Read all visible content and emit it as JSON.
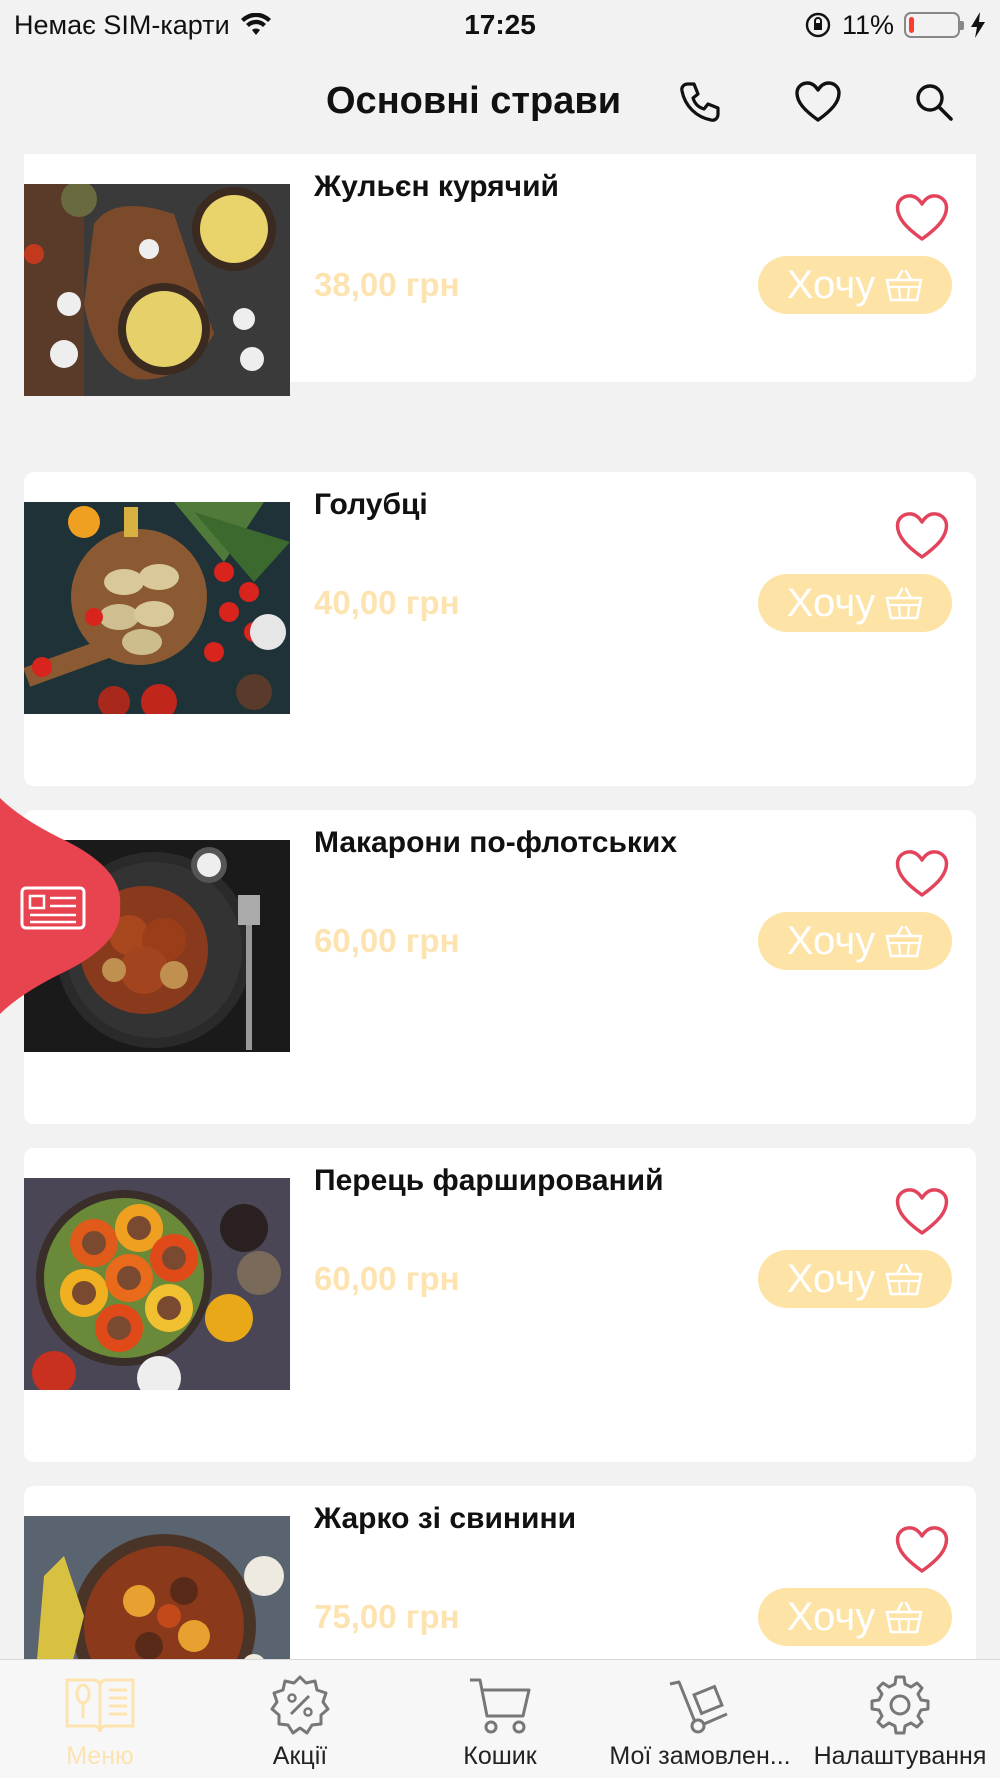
{
  "status_bar": {
    "carrier": "Немає SIM-карти",
    "time": "17:25",
    "battery_percent": "11%",
    "battery_level": 0.11
  },
  "header": {
    "title": "Основні страви",
    "icons": [
      "phone-icon",
      "heart-icon",
      "search-icon"
    ]
  },
  "colors": {
    "accent": "#fde3a6",
    "price": "#fde3b0",
    "heart": "#e2445c",
    "side_tab": "#e8444f"
  },
  "dishes": [
    {
      "name": "Жульєн курячий",
      "price": "38,00 грн",
      "button": "Хочу"
    },
    {
      "name": "Голубці",
      "price": "40,00 грн",
      "button": "Хочу"
    },
    {
      "name": "Макарони по-флотських",
      "price": "60,00 грн",
      "button": "Хочу"
    },
    {
      "name": "Перець фарширований",
      "price": "60,00 грн",
      "button": "Хочу"
    },
    {
      "name": "Жарко зі свинини",
      "price": "75,00 грн",
      "button": "Хочу"
    }
  ],
  "tab_bar": {
    "items": [
      {
        "label": "Меню",
        "icon": "menu-book-icon",
        "active": true
      },
      {
        "label": "Акції",
        "icon": "discount-icon",
        "active": false
      },
      {
        "label": "Кошик",
        "icon": "cart-icon",
        "active": false
      },
      {
        "label": "Мої замовлен...",
        "icon": "hand-truck-icon",
        "active": false
      },
      {
        "label": "Налаштування",
        "icon": "gear-icon",
        "active": false
      }
    ]
  }
}
